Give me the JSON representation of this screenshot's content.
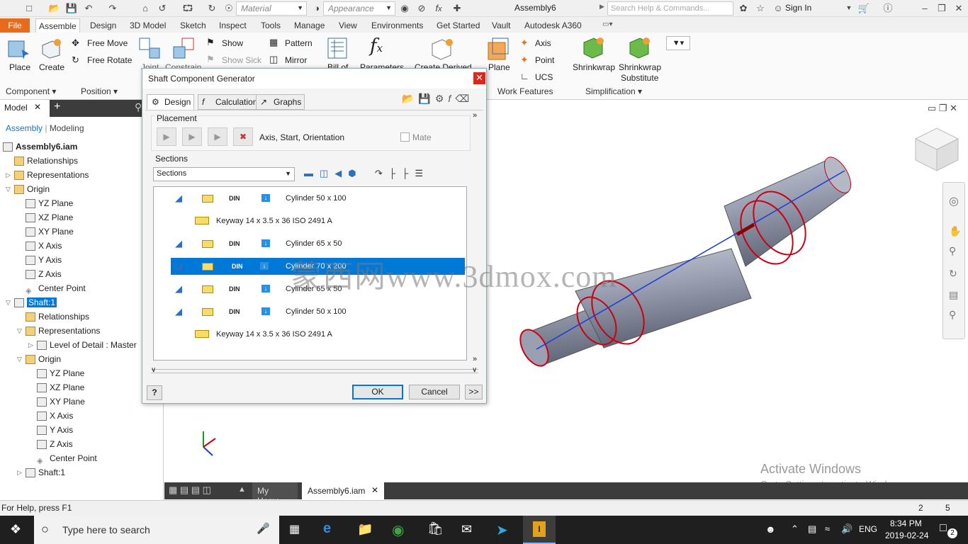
{
  "qat": {
    "material_placeholder": "Material",
    "appearance_placeholder": "Appearance",
    "title": "Assembly6",
    "search_placeholder": "Search Help & Commands...",
    "sign_in": "Sign In"
  },
  "tabs": [
    "File",
    "Assemble",
    "Design",
    "3D Model",
    "Sketch",
    "Inspect",
    "Tools",
    "Manage",
    "View",
    "Environments",
    "Get Started",
    "Vault",
    "Autodesk A360"
  ],
  "ribbon": {
    "place": "Place",
    "create": "Create",
    "free_move": "Free Move",
    "free_rotate": "Free Rotate",
    "joint": "Joint",
    "constrain": "Constrain",
    "show": "Show",
    "show_sick": "Show Sick",
    "pattern": "Pattern",
    "mirror": "Mirror",
    "bill_of": "Bill of",
    "parameters": "Parameters",
    "create_derived": "Create Derived",
    "plane": "Plane",
    "axis": "Axis",
    "point": "Point",
    "ucs": "UCS",
    "shrinkwrap": "Shrinkwrap",
    "shrinkwrap_substitute_1": "Shrinkwrap",
    "shrinkwrap_substitute_2": "Substitute",
    "group_component": "Component",
    "group_position": "Position",
    "group_work_features": "Work Features",
    "group_simplification": "Simplification"
  },
  "browser": {
    "tab_model": "Model",
    "link_assembly": "Assembly",
    "link_modeling": "Modeling",
    "tree": [
      {
        "label": "Assembly6.iam",
        "indent": 0,
        "bold": true
      },
      {
        "label": "Relationships",
        "indent": 1
      },
      {
        "label": "Representations",
        "indent": 1
      },
      {
        "label": "Origin",
        "indent": 1
      },
      {
        "label": "YZ Plane",
        "indent": 2
      },
      {
        "label": "XZ Plane",
        "indent": 2
      },
      {
        "label": "XY Plane",
        "indent": 2
      },
      {
        "label": "X Axis",
        "indent": 2
      },
      {
        "label": "Y Axis",
        "indent": 2
      },
      {
        "label": "Z Axis",
        "indent": 2
      },
      {
        "label": "Center Point",
        "indent": 2
      },
      {
        "label": "Shaft:1",
        "indent": 1,
        "selected": true
      },
      {
        "label": "Relationships",
        "indent": 2
      },
      {
        "label": "Representations",
        "indent": 2
      },
      {
        "label": "Level of Detail : Master",
        "indent": 3
      },
      {
        "label": "Origin",
        "indent": 2
      },
      {
        "label": "YZ Plane",
        "indent": 3
      },
      {
        "label": "XZ Plane",
        "indent": 3
      },
      {
        "label": "XY Plane",
        "indent": 3
      },
      {
        "label": "X Axis",
        "indent": 3
      },
      {
        "label": "Y Axis",
        "indent": 3
      },
      {
        "label": "Z Axis",
        "indent": 3
      },
      {
        "label": "Center Point",
        "indent": 3
      },
      {
        "label": "Shaft:1",
        "indent": 2
      }
    ]
  },
  "dialog": {
    "title": "Shaft Component Generator",
    "tab_design": "Design",
    "tab_calculation": "Calculation",
    "tab_graphs": "Graphs",
    "placement_label": "Placement",
    "placement_text": "Axis, Start, Orientation",
    "mate_label": "Mate",
    "sections_label": "Sections",
    "sections_value": "Sections",
    "rows": [
      {
        "text": "Cylinder 50 x 100",
        "type": "cyl"
      },
      {
        "text": "Keyway 14 x 3.5 x 36 ISO 2491 A",
        "type": "key"
      },
      {
        "text": "Cylinder 65 x 50",
        "type": "cyl"
      },
      {
        "text": "Cylinder 70 x 200",
        "type": "sel"
      },
      {
        "text": "Cylinder 65 x 50",
        "type": "cyl"
      },
      {
        "text": "Cylinder 50 x 100",
        "type": "cyl"
      },
      {
        "text": "Keyway 14 x 3.5 x 36 ISO 2491 A",
        "type": "key"
      }
    ],
    "ok": "OK",
    "cancel": "Cancel",
    "more": ">>"
  },
  "viewport": {
    "activate_title": "Activate Windows",
    "activate_sub": "Go to Settings to activate Windows.",
    "watermark": "蒙西网www.3dmox.com"
  },
  "bottom_tabs": {
    "my_home": "My Home",
    "doc": "Assembly6.iam"
  },
  "status": {
    "help": "For Help, press F1",
    "n1": "2",
    "n2": "5"
  },
  "taskbar": {
    "search_placeholder": "Type here to search",
    "lang": "ENG",
    "time": "8:34 PM",
    "date": "2019-02-24",
    "notif": "2"
  },
  "colors": {
    "file_tab": "#e66c1c",
    "selection": "#0078d7",
    "shaft": "#8d93a6",
    "groove": "#cc1f1f"
  }
}
